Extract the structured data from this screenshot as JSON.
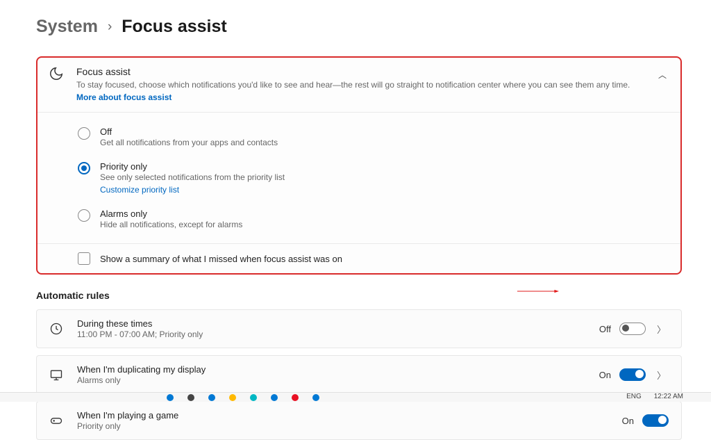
{
  "breadcrumb": {
    "item1": "System",
    "sep": "›",
    "item2": "Focus assist"
  },
  "panel": {
    "title": "Focus assist",
    "desc": "To stay focused, choose which notifications you'd like to see and hear—the rest will go straight to notification center where you can see them any time.",
    "link": "More about focus assist"
  },
  "options": [
    {
      "title": "Off",
      "desc": "Get all notifications from your apps and contacts"
    },
    {
      "title": "Priority only",
      "desc": "See only selected notifications from the priority list",
      "link": "Customize priority list"
    },
    {
      "title": "Alarms only",
      "desc": "Hide all notifications, except for alarms"
    }
  ],
  "summary": {
    "label": "Show a summary of what I missed when focus assist was on"
  },
  "section2": {
    "title": "Automatic rules"
  },
  "rules": [
    {
      "title": "During these times",
      "desc": "11:00 PM - 07:00 AM; Priority only",
      "state": "Off"
    },
    {
      "title": "When I'm duplicating my display",
      "desc": "Alarms only",
      "state": "On"
    },
    {
      "title": "When I'm playing a game",
      "desc": "Priority only",
      "state": "On"
    }
  ],
  "taskbar": {
    "lang": "ENG",
    "time": "12:22 AM"
  }
}
